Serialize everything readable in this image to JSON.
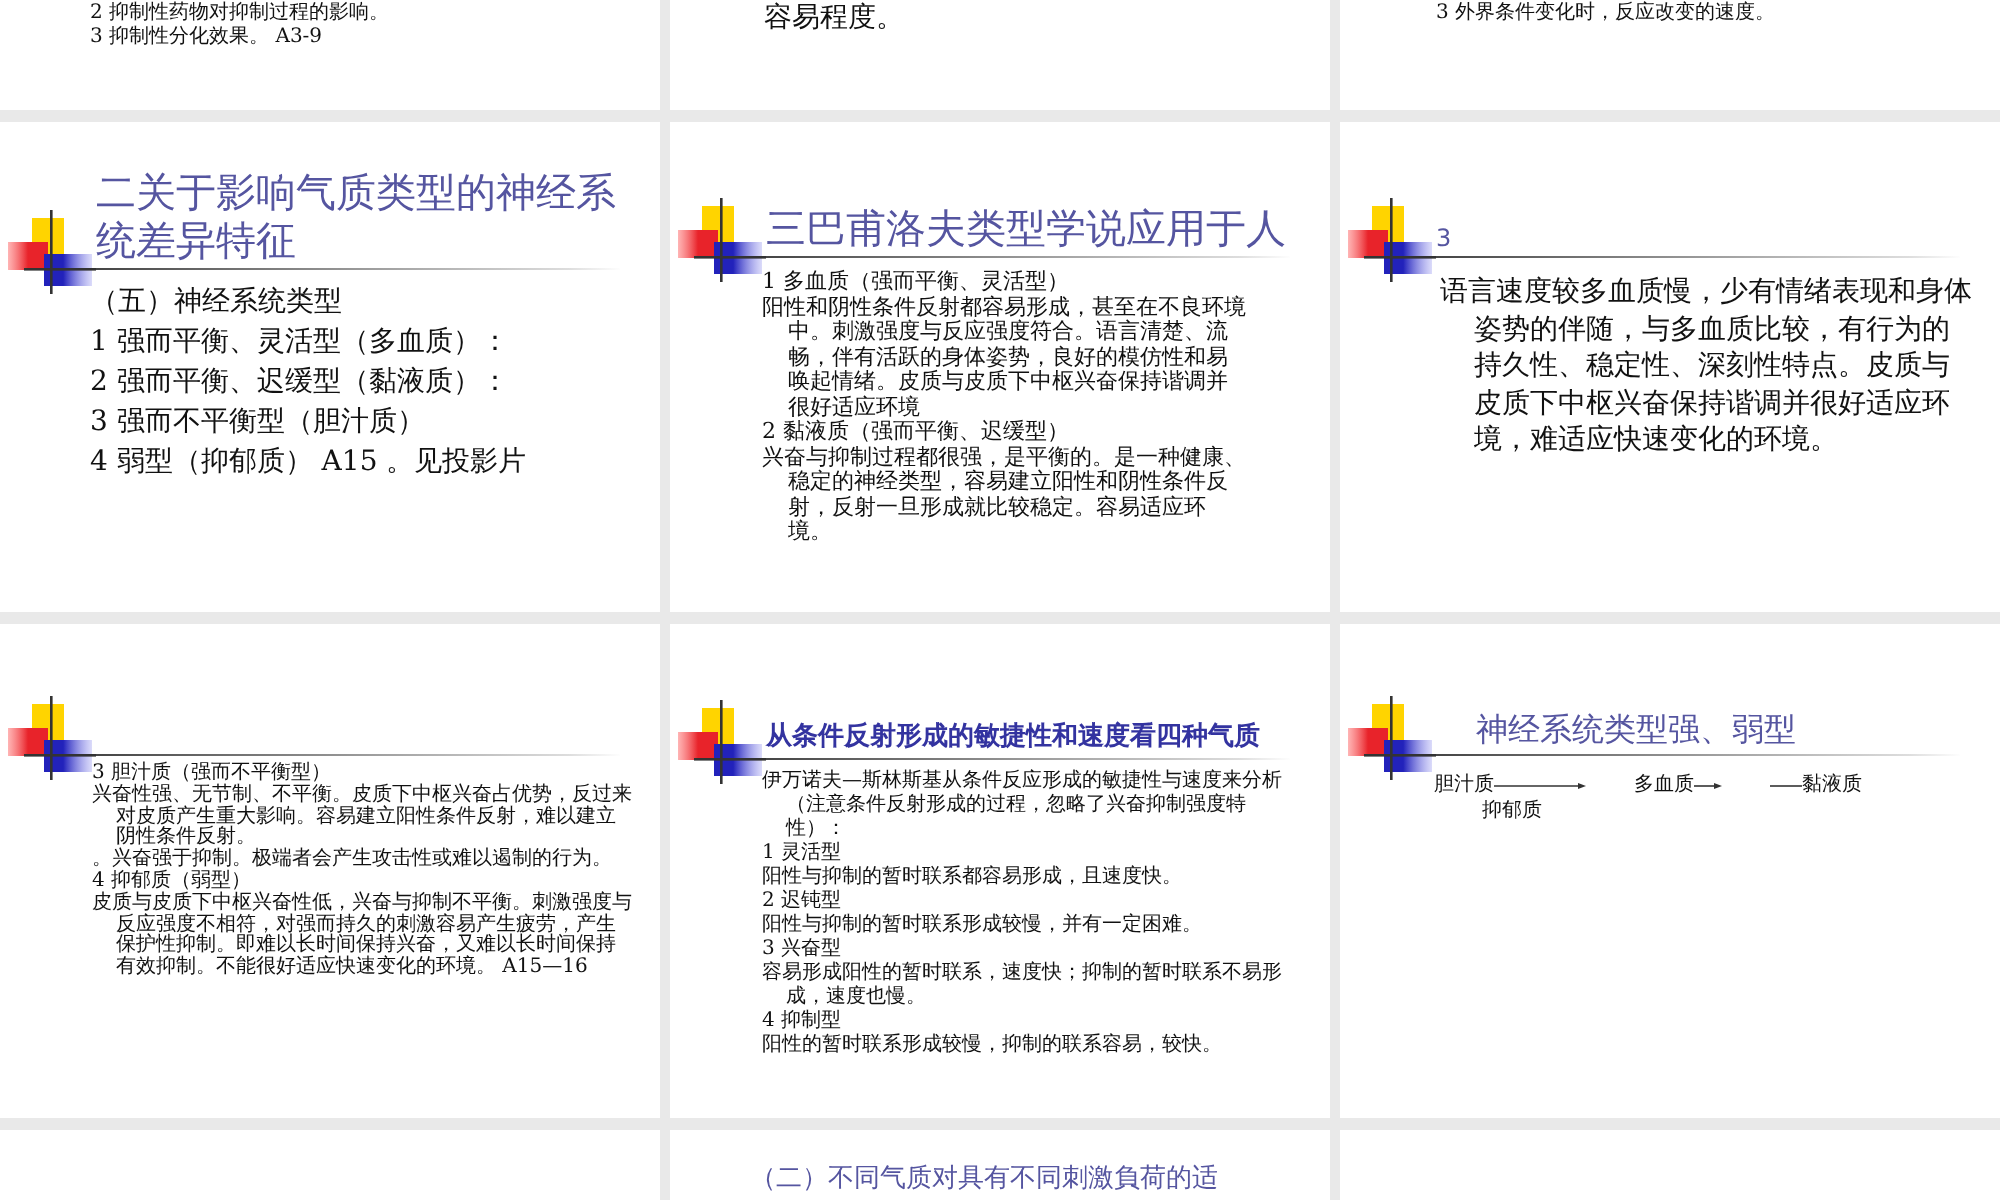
{
  "slides": [
    {
      "kind": "plain",
      "lines": [
        "2 抑制性药物对抑制过程的影响。",
        "3 抑制性分化效果。 A3-9"
      ]
    },
    {
      "kind": "plain",
      "lines": [
        "容易程度。"
      ]
    },
    {
      "kind": "plain",
      "lines": [
        "3 外界条件变化时，反应改变的速度。"
      ]
    },
    {
      "kind": "titled",
      "title": "二关于影响气质类型的神经系统差异特征",
      "lines": [
        "（五）神经系统类型",
        "1 强而平衡、灵活型（多血质）：",
        "2 强而平衡、迟缓型（黏液质）：",
        "3 强而不平衡型（胆汁质）",
        "4 弱型（抑郁质）  A15 。见投影片"
      ]
    },
    {
      "kind": "titled",
      "title": "三巴甫洛夫类型学说应用于人",
      "lines": [
        "1 多血质（强而平衡、灵活型）",
        "阳性和阴性条件反射都容易形成，甚至在不良环境中。刺激强度与反应强度符合。语言清楚、流畅，伴有活跃的身体姿势，良好的模仿性和易唤起情绪。皮质与皮质下中枢兴奋保持谐调并很好适应环境",
        "2 黏液质（强而平衡、迟缓型）",
        "兴奋与抑制过程都很强，是平衡的。是一种健康、稳定的神经类型，容易建立阳性和阴性条件反射，反射一旦形成就比较稳定。容易适应环境。"
      ]
    },
    {
      "kind": "titled",
      "title": "3",
      "lines": [
        "语言速度较多血质慢，少有情绪表现和身体姿势的伴随，与多血质比较，有行为的持久性、稳定性、深刻性特点。皮质与皮质下中枢兴奋保持谐调并很好适应环境，难适应快速变化的环境。"
      ]
    },
    {
      "kind": "titled",
      "lines": [
        "3 胆汁质（强而不平衡型）",
        "兴奋性强、无节制、不平衡。皮质下中枢兴奋占优势，反过来对皮质产生重大影响。容易建立阳性条件反射，难以建立阴性条件反射。",
        "。兴奋强于抑制。极端者会产生攻击性或难以遏制的行为。",
        "4 抑郁质（弱型）",
        "皮质与皮质下中枢兴奋性低，兴奋与抑制不平衡。刺激强度与反应强度不相符，对强而持久的刺激容易产生疲劳，产生保护性抑制。即难以长时间保持兴奋，又难以长时间保持有效抑制。不能很好适应快速变化的环境。 A15—16"
      ]
    },
    {
      "kind": "titled",
      "title": "从条件反射形成的敏捷性和速度看四种气质",
      "title_bold": true,
      "lines": [
        "伊万诺夫—斯林斯基从条件反应形成的敏捷性与速度来分析（注意条件反射形成的过程，忽略了兴奋抑制强度特性）：",
        "1 灵活型",
        "阳性与抑制的暂时联系都容易形成，且速度快。",
        "2 迟钝型",
        "阳性与抑制的暂时联系形成较慢，并有一定困难。",
        "3 兴奋型",
        "容易形成阳性的暂时联系，速度快；抑制的暂时联系不易形成，速度也慢。",
        "4 抑制型",
        "阳性的暂时联系形成较慢，抑制的联系容易，较快。"
      ]
    },
    {
      "kind": "diagram",
      "title": "神经系统类型强、弱型",
      "nodes": [
        "胆汁质",
        "多血质",
        "黏液质",
        "抑郁质"
      ]
    },
    {
      "kind": "plain"
    },
    {
      "kind": "plain",
      "title": "（二）不同气质对具有不同刺激負荷的适"
    },
    {
      "kind": "plain"
    }
  ]
}
